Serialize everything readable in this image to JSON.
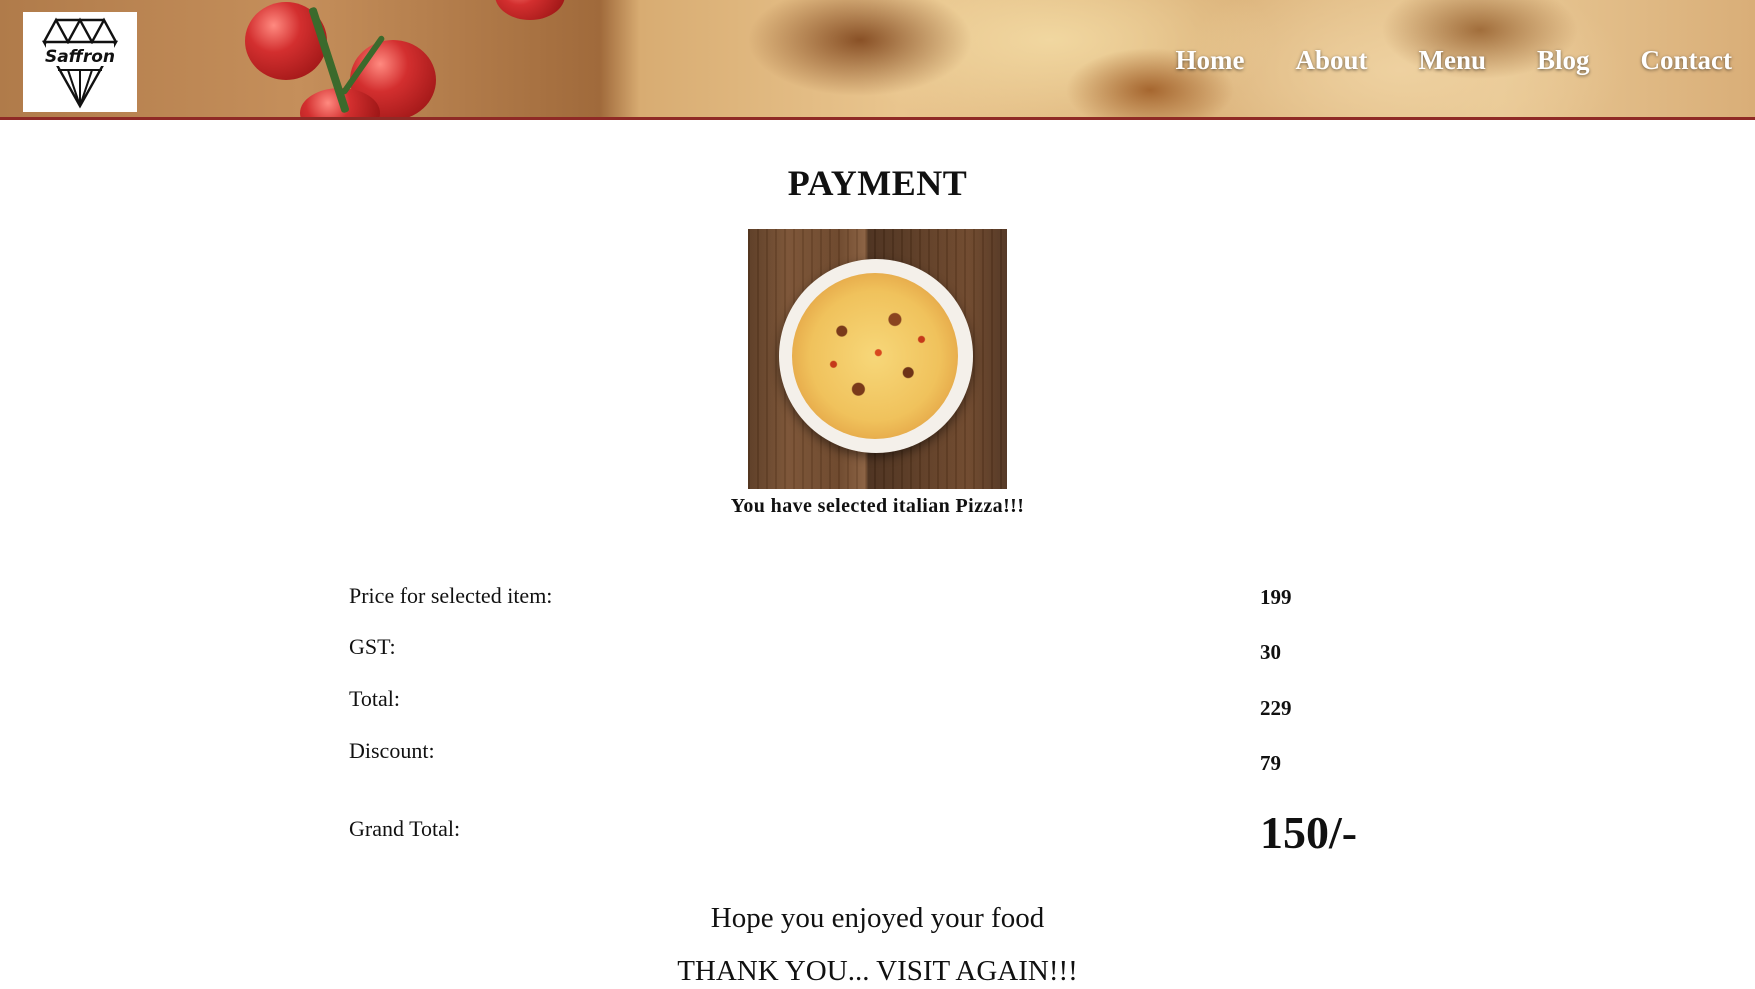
{
  "header": {
    "logo_text": "Saffron",
    "nav": [
      {
        "label": "Home"
      },
      {
        "label": "About"
      },
      {
        "label": "Menu"
      },
      {
        "label": "Blog"
      },
      {
        "label": "Contact"
      }
    ]
  },
  "main": {
    "title": "PAYMENT",
    "selection_text": "You have selected italian Pizza!!!",
    "rows": [
      {
        "label": "Price for selected item:",
        "value": "199"
      },
      {
        "label": "GST:",
        "value": "30"
      },
      {
        "label": "Total:",
        "value": "229"
      },
      {
        "label": "Discount:",
        "value": "79"
      }
    ],
    "grand_total": {
      "label": "Grand Total:",
      "value": "150/-"
    },
    "footer_line1": "Hope you enjoyed your food",
    "footer_line2": "THANK YOU... VISIT AGAIN!!!"
  },
  "colors": {
    "header_border": "#8f2a26",
    "nav_text": "#ffffff"
  }
}
